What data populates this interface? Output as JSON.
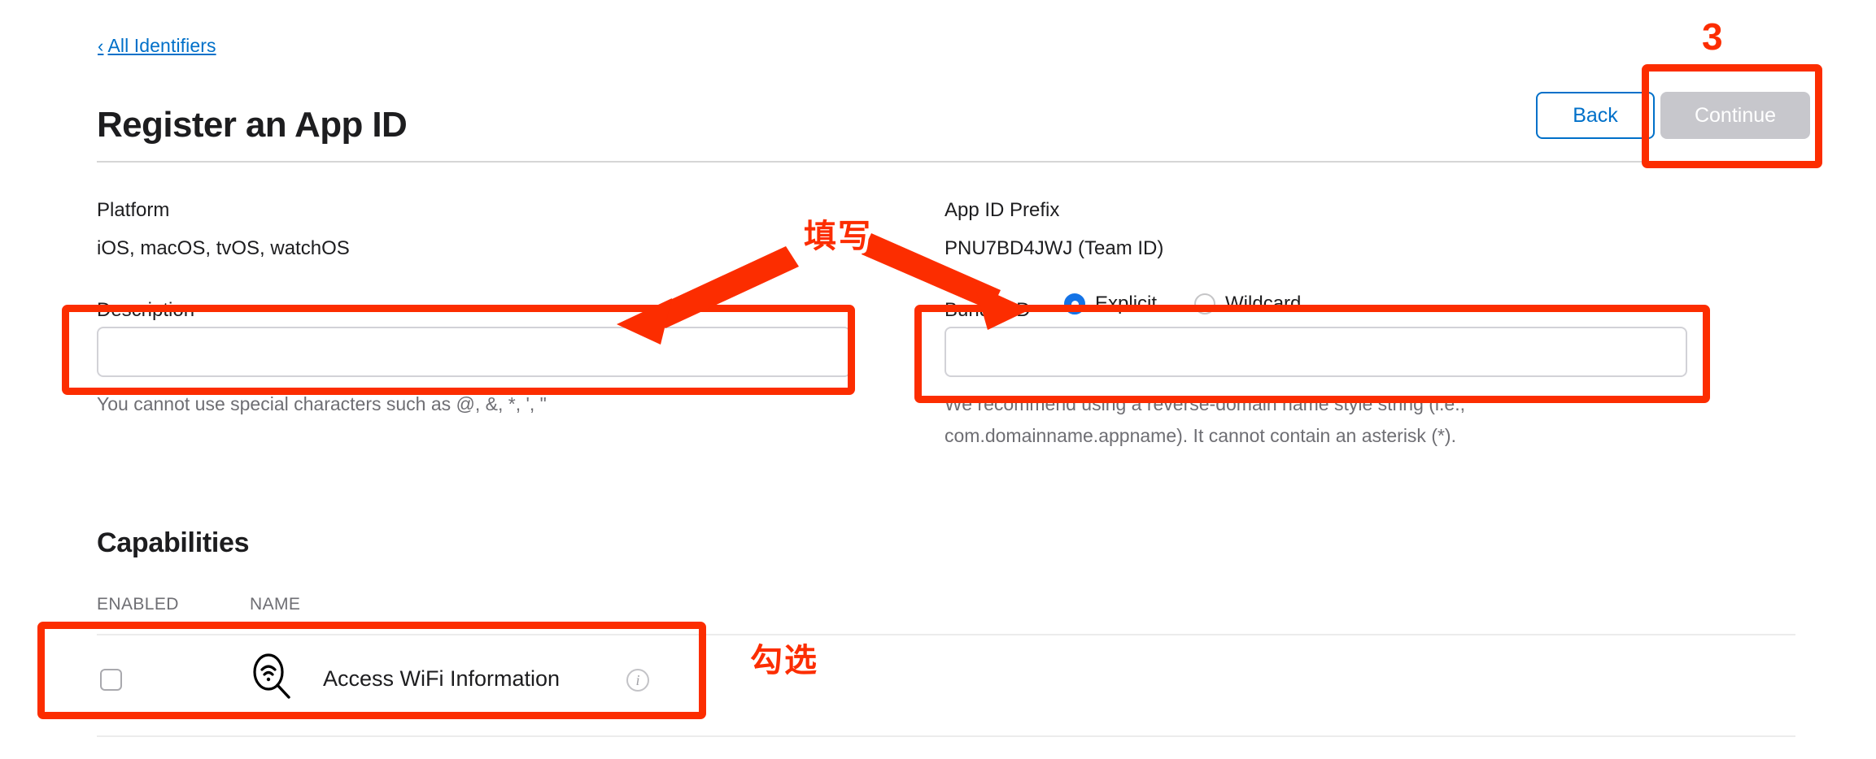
{
  "breadcrumb": {
    "icon": "chevron-left-icon",
    "label": "All Identifiers",
    "chevron": "‹"
  },
  "header": {
    "title": "Register an App ID",
    "back_label": "Back",
    "continue_label": "Continue"
  },
  "form": {
    "platform": {
      "label": "Platform",
      "value": "iOS, macOS, tvOS, watchOS"
    },
    "description": {
      "label": "Description",
      "value": "",
      "placeholder": "",
      "help": "You cannot use special characters such as @, &, *, ', \""
    },
    "app_id_prefix": {
      "label": "App ID Prefix",
      "value": "PNU7BD4JWJ (Team ID)"
    },
    "bundle_id": {
      "label": "Bundle ID",
      "options": [
        {
          "label": "Explicit",
          "selected": true
        },
        {
          "label": "Wildcard",
          "selected": false
        }
      ],
      "value": "",
      "placeholder": "",
      "help_line1": "We recommend using a reverse-domain name style string (i.e.,",
      "help_line2": "com.domainname.appname). It cannot contain an asterisk (*)."
    }
  },
  "capabilities": {
    "title": "Capabilities",
    "columns": {
      "enabled": "ENABLED",
      "name": "NAME"
    },
    "rows": [
      {
        "enabled": false,
        "icon": "wifi-search-icon",
        "name": "Access WiFi Information",
        "info": "ℹ"
      }
    ]
  },
  "annotations": {
    "color": "#fc2d00",
    "step_number": "3",
    "fill_in_label": "填写",
    "check_label": "勾选"
  }
}
